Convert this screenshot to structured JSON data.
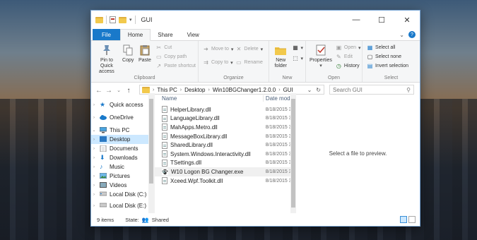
{
  "window": {
    "title": "GUI",
    "controls": [
      "—",
      "☐",
      "✕"
    ]
  },
  "tabs": [
    {
      "label": "File"
    },
    {
      "label": "Home"
    },
    {
      "label": "Share"
    },
    {
      "label": "View"
    }
  ],
  "ribbon": {
    "clipboard": {
      "label": "Clipboard",
      "pin": "Pin to Quick access",
      "copy": "Copy",
      "paste": "Paste",
      "cut": "Cut",
      "copy_path": "Copy path",
      "paste_shortcut": "Paste shortcut"
    },
    "organize": {
      "label": "Organize",
      "move_to": "Move to",
      "copy_to": "Copy to",
      "delete": "Delete",
      "rename": "Rename"
    },
    "new": {
      "label": "New",
      "new_folder": "New folder"
    },
    "open": {
      "label": "Open",
      "properties": "Properties",
      "open": "Open",
      "edit": "Edit",
      "history": "History"
    },
    "select": {
      "label": "Select",
      "select_all": "Select all",
      "select_none": "Select none",
      "invert": "Invert selection"
    }
  },
  "address": {
    "crumbs": [
      "This PC",
      "Desktop",
      "Win10BGChanger1.2.0.0",
      "GUI"
    ],
    "search_placeholder": "Search GUI"
  },
  "nav": [
    {
      "label": "Quick access",
      "icon": "star-icon"
    },
    {
      "label": "OneDrive",
      "icon": "cloud-icon"
    },
    {
      "label": "This PC",
      "icon": "computer-icon"
    },
    {
      "label": "Desktop",
      "icon": "desktop-icon"
    },
    {
      "label": "Documents",
      "icon": "documents-icon"
    },
    {
      "label": "Downloads",
      "icon": "downloads-icon"
    },
    {
      "label": "Music",
      "icon": "music-icon"
    },
    {
      "label": "Pictures",
      "icon": "pictures-icon"
    },
    {
      "label": "Videos",
      "icon": "videos-icon"
    },
    {
      "label": "Local Disk (C:)",
      "icon": "drive-icon"
    },
    {
      "label": "Local Disk (E:)",
      "icon": "drive-icon"
    }
  ],
  "columns": {
    "name": "Name",
    "date": "Date modifi"
  },
  "files": [
    {
      "name": "HelperLibrary.dll",
      "date": "8/18/2015 3"
    },
    {
      "name": "LanguageLibrary.dll",
      "date": "8/18/2015 3"
    },
    {
      "name": "MahApps.Metro.dll",
      "date": "8/18/2015 3"
    },
    {
      "name": "MessageBoxLibrary.dll",
      "date": "8/18/2015 3"
    },
    {
      "name": "SharedLibrary.dll",
      "date": "8/18/2015 3"
    },
    {
      "name": "System.Windows.Interactivity.dll",
      "date": "8/18/2015 3"
    },
    {
      "name": "TSettings.dll",
      "date": "8/18/2015 3"
    },
    {
      "name": "W10 Logon BG Changer.exe",
      "date": "8/18/2015 3"
    },
    {
      "name": "Xceed.Wpf.Toolkit.dll",
      "date": "8/18/2015 3"
    }
  ],
  "preview_text": "Select a file to preview.",
  "status": {
    "items": "9 items",
    "state_label": "State:",
    "state_value": "Shared"
  },
  "colors": {
    "accent": "#1979ca",
    "selected": "#cce8ff"
  }
}
